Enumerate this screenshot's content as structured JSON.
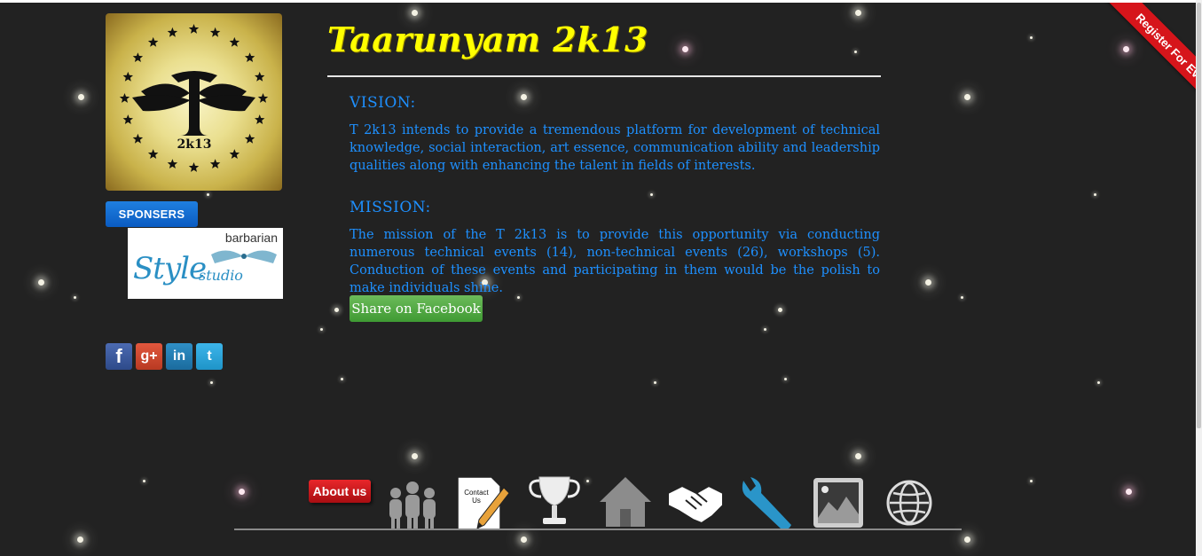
{
  "logo": {
    "text": "2k13",
    "monogram": "T"
  },
  "sponsors": {
    "button_label": "SPONSERS",
    "logo_top": "barbarian",
    "logo_script": "Style",
    "logo_studio": "studio"
  },
  "social": [
    "f",
    "g+",
    "in",
    "t"
  ],
  "ribbon": {
    "label": "Register For Event"
  },
  "main": {
    "title": "Taarunyam 2k13",
    "vision_heading": "VISION:",
    "vision_text": "T 2k13 intends to provide a tremendous platform for development of technical knowledge, social interaction, art essence, communication ability and leadership qualities along with enhancing the talent in fields of interests.",
    "mission_heading": "MISSION:",
    "mission_text": "The mission of the T 2k13 is to provide this opportunity via conducting numerous technical events (14), non-technical events (26), workshops (5). Conduction of these events and participating in them would be the polish to make individuals shine.",
    "share_label": "Share on Facebook"
  },
  "dock": {
    "about_label": "About us",
    "contact_label": "Contact Us",
    "items": [
      "people-icon",
      "contact-icon",
      "trophy-icon",
      "home-icon",
      "handshake-icon",
      "wrench-icon",
      "gallery-icon",
      "globe-icon"
    ]
  },
  "colors": {
    "background": "#222222",
    "title": "#ffff00",
    "text": "#1e90ff",
    "ribbon": "#d6151b",
    "share": "#4fa63f"
  }
}
